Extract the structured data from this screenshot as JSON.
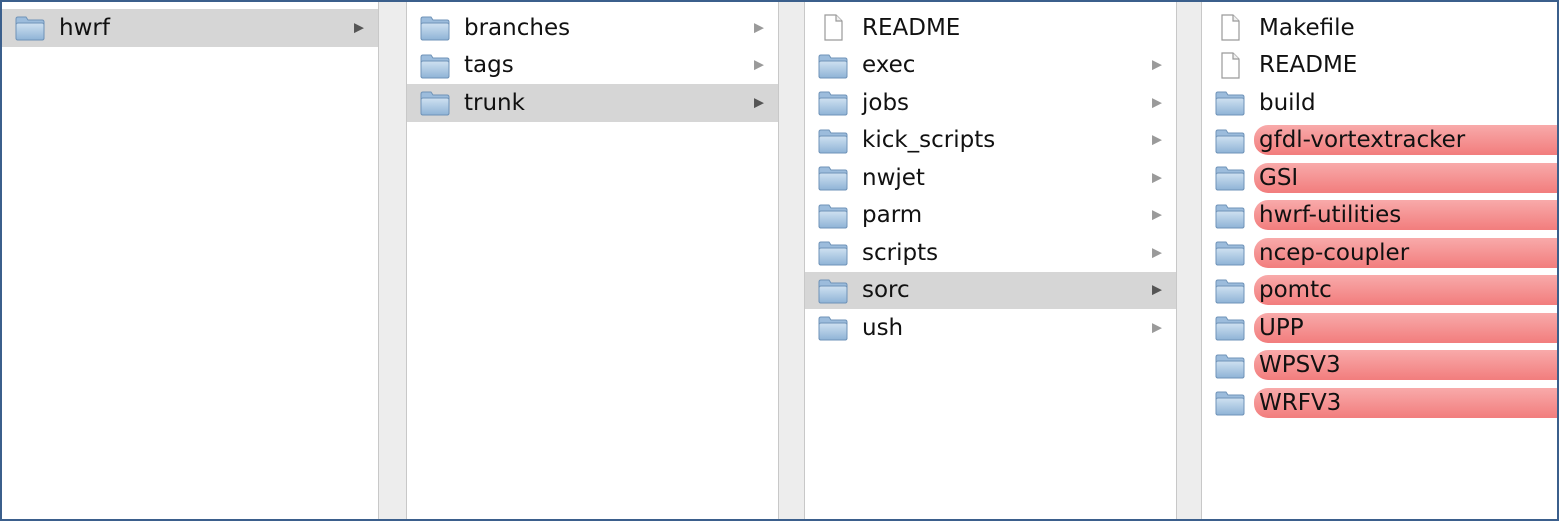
{
  "columns": [
    {
      "items": [
        {
          "label": "hwrf",
          "type": "folder",
          "has_children": true,
          "selected": true,
          "label_color": null
        }
      ]
    },
    {
      "items": [
        {
          "label": "branches",
          "type": "folder",
          "has_children": true,
          "selected": false,
          "label_color": null
        },
        {
          "label": "tags",
          "type": "folder",
          "has_children": true,
          "selected": false,
          "label_color": null
        },
        {
          "label": "trunk",
          "type": "folder",
          "has_children": true,
          "selected": true,
          "label_color": null
        }
      ]
    },
    {
      "items": [
        {
          "label": "README",
          "type": "file",
          "has_children": false,
          "selected": false,
          "label_color": null
        },
        {
          "label": "exec",
          "type": "folder",
          "has_children": true,
          "selected": false,
          "label_color": null
        },
        {
          "label": "jobs",
          "type": "folder",
          "has_children": true,
          "selected": false,
          "label_color": null
        },
        {
          "label": "kick_scripts",
          "type": "folder",
          "has_children": true,
          "selected": false,
          "label_color": null
        },
        {
          "label": "nwjet",
          "type": "folder",
          "has_children": true,
          "selected": false,
          "label_color": null
        },
        {
          "label": "parm",
          "type": "folder",
          "has_children": true,
          "selected": false,
          "label_color": null
        },
        {
          "label": "scripts",
          "type": "folder",
          "has_children": true,
          "selected": false,
          "label_color": null
        },
        {
          "label": "sorc",
          "type": "folder",
          "has_children": true,
          "selected": true,
          "label_color": null
        },
        {
          "label": "ush",
          "type": "folder",
          "has_children": true,
          "selected": false,
          "label_color": null
        }
      ]
    },
    {
      "items": [
        {
          "label": "Makefile",
          "type": "file",
          "has_children": false,
          "selected": false,
          "label_color": null
        },
        {
          "label": "README",
          "type": "file",
          "has_children": false,
          "selected": false,
          "label_color": null
        },
        {
          "label": "build",
          "type": "folder",
          "has_children": true,
          "selected": false,
          "label_color": null
        },
        {
          "label": "gfdl-vortextracker",
          "type": "folder",
          "has_children": true,
          "selected": false,
          "label_color": "#f27d7d"
        },
        {
          "label": "GSI",
          "type": "folder",
          "has_children": true,
          "selected": false,
          "label_color": "#f27d7d"
        },
        {
          "label": "hwrf-utilities",
          "type": "folder",
          "has_children": true,
          "selected": false,
          "label_color": "#f27d7d"
        },
        {
          "label": "ncep-coupler",
          "type": "folder",
          "has_children": true,
          "selected": false,
          "label_color": "#f27d7d"
        },
        {
          "label": "pomtc",
          "type": "folder",
          "has_children": true,
          "selected": false,
          "label_color": "#f27d7d"
        },
        {
          "label": "UPP",
          "type": "folder",
          "has_children": true,
          "selected": false,
          "label_color": "#f27d7d"
        },
        {
          "label": "WPSV3",
          "type": "folder",
          "has_children": true,
          "selected": false,
          "label_color": "#f27d7d"
        },
        {
          "label": "WRFV3",
          "type": "folder",
          "has_children": true,
          "selected": false,
          "label_color": "#f27d7d"
        }
      ]
    }
  ],
  "icons": {
    "folder": "folder-icon",
    "file": "document-icon",
    "disclosure": "disclosure-arrow-icon",
    "disclosure_glyph": "▶"
  },
  "colors": {
    "selection": "#d6d6d6",
    "red_label": "#f27d7d",
    "folder_fill": "#a9c8e4",
    "window_border": "#3b5f8c"
  }
}
